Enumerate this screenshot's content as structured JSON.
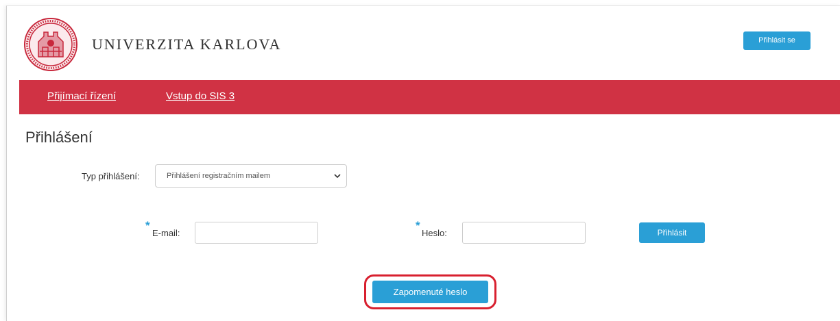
{
  "header": {
    "brand": "UNIVERZITA KARLOVA",
    "login_button": "Přihlásit se",
    "logo_icon": "university-seal-icon"
  },
  "nav": {
    "items": [
      {
        "label": "Přijímací řízení"
      },
      {
        "label": "Vstup do SIS 3"
      }
    ]
  },
  "main": {
    "title": "Přihlášení",
    "login_type": {
      "label": "Typ přihlášení:",
      "selected": "Přihlášení registračním mailem"
    },
    "email": {
      "required_mark": "*",
      "label": "E-mail:",
      "value": ""
    },
    "password": {
      "required_mark": "*",
      "label": "Heslo:",
      "value": ""
    },
    "submit_button": "Přihlásit",
    "forgot_button": "Zapomenuté heslo"
  },
  "colors": {
    "nav_bar": "#d03244",
    "button": "#2a9fd6",
    "highlight": "#d8202f"
  }
}
